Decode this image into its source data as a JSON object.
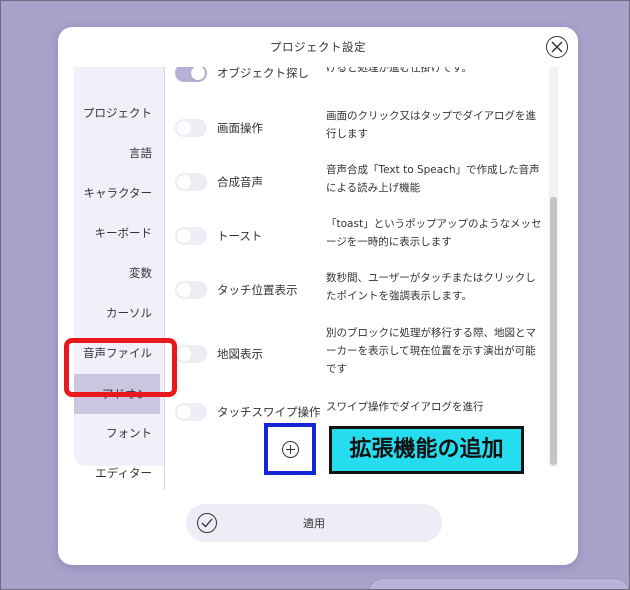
{
  "dialog": {
    "title": "プロジェクト設定",
    "apply_label": "適用"
  },
  "sidebar": {
    "items": [
      {
        "label": "プロジェクト"
      },
      {
        "label": "言語"
      },
      {
        "label": "キャラクター"
      },
      {
        "label": "キーボード"
      },
      {
        "label": "変数"
      },
      {
        "label": "カーソル"
      },
      {
        "label": "音声ファイル"
      },
      {
        "label": "アドオン",
        "active": true
      },
      {
        "label": "フォント"
      },
      {
        "label": "エディター"
      }
    ]
  },
  "addons": [
    {
      "name": "オブジェクト探し",
      "enabled": true,
      "desc": "けると処理が進む仕掛けです。"
    },
    {
      "name": "画面操作",
      "enabled": false,
      "desc": "画面のクリック又はタップでダイアログを進行します"
    },
    {
      "name": "合成音声",
      "enabled": false,
      "desc": "音声合成「Text to Speach」で作成した音声 による読み上げ機能"
    },
    {
      "name": "トースト",
      "enabled": false,
      "desc": "「toast」というポップアップのようなメッセージを一時的に表示します"
    },
    {
      "name": "タッチ位置表示",
      "enabled": false,
      "desc": "数秒間、ユーザーがタッチまたはクリックしたポイントを強調表示します。"
    },
    {
      "name": "地図表示",
      "enabled": false,
      "desc": "別のブロックに処理が移行する際、地図とマーカーを表示して現在位置を示す演出が可能です"
    },
    {
      "name": "タッチスワイプ操作",
      "enabled": false,
      "desc": "スワイプ操作でダイアログを進行"
    }
  ],
  "annotation": {
    "callout_text": "拡張機能の追加"
  },
  "colors": {
    "background": "#aba2cc",
    "active_item": "#cbc6e0",
    "highlight_red": "#e8181c",
    "highlight_blue": "#1228d8",
    "callout_bg": "#26ddf0"
  },
  "icons": {
    "close": "close-icon",
    "add": "plus-circle-icon",
    "apply": "check-circle-icon"
  }
}
